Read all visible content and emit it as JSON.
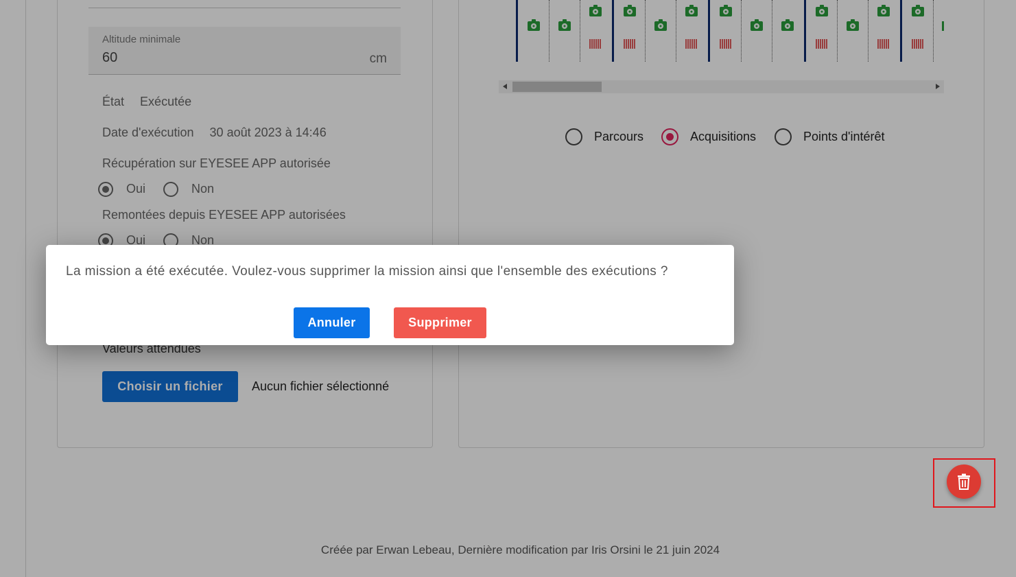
{
  "form": {
    "altitude_label": "Altitude minimale",
    "altitude_value": "60",
    "altitude_unit": "cm",
    "etat_label": "État",
    "etat_value": "Exécutée",
    "date_label": "Date d'exécution",
    "date_value": "30 août 2023 à 14:46",
    "recuperation_label": "Récupération sur EYESEE APP autorisée",
    "remontees_label": "Remontées depuis EYESEE APP autorisées",
    "oui_label": "Oui",
    "non_label": "Non",
    "valeurs_label": "Valeurs attendues",
    "file_button_label": "Choisir un fichier",
    "file_status": "Aucun fichier sélectionné"
  },
  "view_mode": {
    "options": [
      "Parcours",
      "Acquisitions",
      "Points d'intérêt"
    ],
    "selected": "Acquisitions"
  },
  "dialog": {
    "message": "La mission a été exécutée. Voulez-vous supprimer la mission ainsi que l'ensemble des exécutions ?",
    "cancel_label": "Annuler",
    "delete_label": "Supprimer"
  },
  "footer": {
    "text": "Créée par Erwan Lebeau, Dernière modification par Iris Orsini le 21 juin 2024"
  },
  "colors": {
    "primary": "#0b74e8",
    "danger": "#f1584f",
    "fab": "#dc3b33",
    "radio_accent": "#e0245e",
    "camera_green": "#2a9d3b"
  }
}
